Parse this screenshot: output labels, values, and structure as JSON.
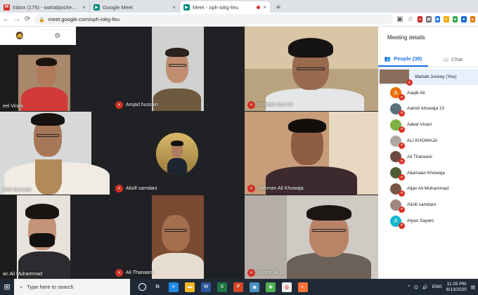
{
  "browser": {
    "tabs": [
      {
        "title": "Inbox (175) - wahabjockey@gm...",
        "active": false,
        "favicon_color": "#d93025",
        "favicon_glyph": "M"
      },
      {
        "title": "Google Meet",
        "active": false,
        "favicon_color": "#00897b",
        "favicon_glyph": "▶"
      },
      {
        "title": "Meet - oph-iokg-feu",
        "active": true,
        "favicon_color": "#00897b",
        "favicon_glyph": "▶"
      }
    ],
    "new_tab_glyph": "+",
    "close_glyph": "×",
    "url": "meet.google.com/oph-iokg-feu",
    "nav": {
      "back": "←",
      "forward": "→",
      "reload": "⟳"
    }
  },
  "self_view": {
    "settings_icon": "gear-icon",
    "avatar_emoji": "🧔"
  },
  "tiles": [
    {
      "name": "Adeel Virani",
      "display": "eel Virani"
    },
    {
      "name": "Amjad hussain",
      "display": "Amjad hussain"
    },
    {
      "name": "Shahab Amir Ali",
      "display": "Shahab Amir Ali"
    },
    {
      "name": "Aarish Khowaja",
      "display": "irish khowaja"
    },
    {
      "name": "Alizill samdani",
      "display": "Alizill samdani"
    },
    {
      "name": "Rahman Ali Khuwaja",
      "display": "Rahman Ali Khuwaja"
    },
    {
      "name": "Aljan Ali Muhammad",
      "display": "an Ali Muhammad"
    },
    {
      "name": "Ali Tharwani",
      "display": "Ali Tharwani"
    },
    {
      "name": "Kashif ali",
      "display": "Kashif ali"
    }
  ],
  "panel": {
    "title": "Meeting details",
    "tab_people": "People (38)",
    "tab_chat": "Chat",
    "people": [
      {
        "name": "Wahab Jockey (You)",
        "initial": "",
        "color": "#8a6d5a",
        "self": true
      },
      {
        "name": "Aaqib Ali",
        "initial": "A",
        "color": "#e8710a"
      },
      {
        "name": "Aarish khowaja 10",
        "initial": "",
        "color": "#5b6f7a"
      },
      {
        "name": "Adeel Virani",
        "initial": "",
        "color": "#7cb342"
      },
      {
        "name": "ALI KHOWAJA",
        "initial": "",
        "color": "#b0a8a0"
      },
      {
        "name": "Ali Tharwani",
        "initial": "",
        "color": "#6d4c41"
      },
      {
        "name": "Aliamaan Khowaja",
        "initial": "",
        "color": "#4e5b31"
      },
      {
        "name": "Aljan Ali Muhammad",
        "initial": "",
        "color": "#795548"
      },
      {
        "name": "Alizill samdani",
        "initial": "",
        "color": "#a1887f"
      },
      {
        "name": "Alyan Sayani",
        "initial": "A",
        "color": "#12b5cb"
      }
    ]
  },
  "taskbar": {
    "search_placeholder": "Type here to search",
    "time": "11:25 PM",
    "date": "6/13/2020",
    "lang": "ENG"
  }
}
